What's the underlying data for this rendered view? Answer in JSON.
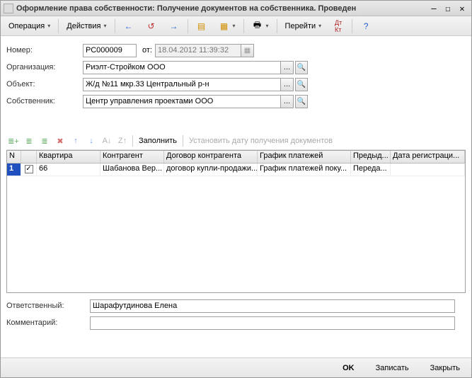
{
  "window": {
    "title": "Оформление права собственности: Получение документов на собственника. Проведен"
  },
  "toolbar": {
    "operation": "Операция",
    "actions": "Действия",
    "goto": "Перейти"
  },
  "form": {
    "number_label": "Номер:",
    "number_value": "РС000009",
    "from_label": "от:",
    "date_value": "18.04.2012 11:39:32",
    "org_label": "Организация:",
    "org_value": "Риэлт-Стройком ООО",
    "object_label": "Объект:",
    "object_value": "Ж/д №11 мкр.33 Центральный р-н",
    "owner_label": "Собственник:",
    "owner_value": "Центр управления проектами ООО",
    "resp_label": "Ответственный:",
    "resp_value": "Шарафутдинова Елена",
    "comment_label": "Комментарий:",
    "comment_value": ""
  },
  "subtoolbar": {
    "fill": "Заполнить",
    "set_date": "Установить дату получения документов"
  },
  "grid": {
    "headers": {
      "n": "N",
      "chk": "",
      "flat": "Квартира",
      "counterparty": "Контрагент",
      "contract": "Договор контрагента",
      "schedule": "График платежей",
      "prev": "Предыд...",
      "regdate": "Дата регистраци..."
    },
    "rows": [
      {
        "n": "1",
        "checked": true,
        "flat": "66",
        "counterparty": "Шабанова Вер...",
        "contract": "договор купли-продажи...",
        "schedule": "График платежей поку...",
        "prev": "Переда...",
        "regdate": ""
      }
    ]
  },
  "buttons": {
    "ok": "OK",
    "save": "Записать",
    "close": "Закрыть"
  }
}
